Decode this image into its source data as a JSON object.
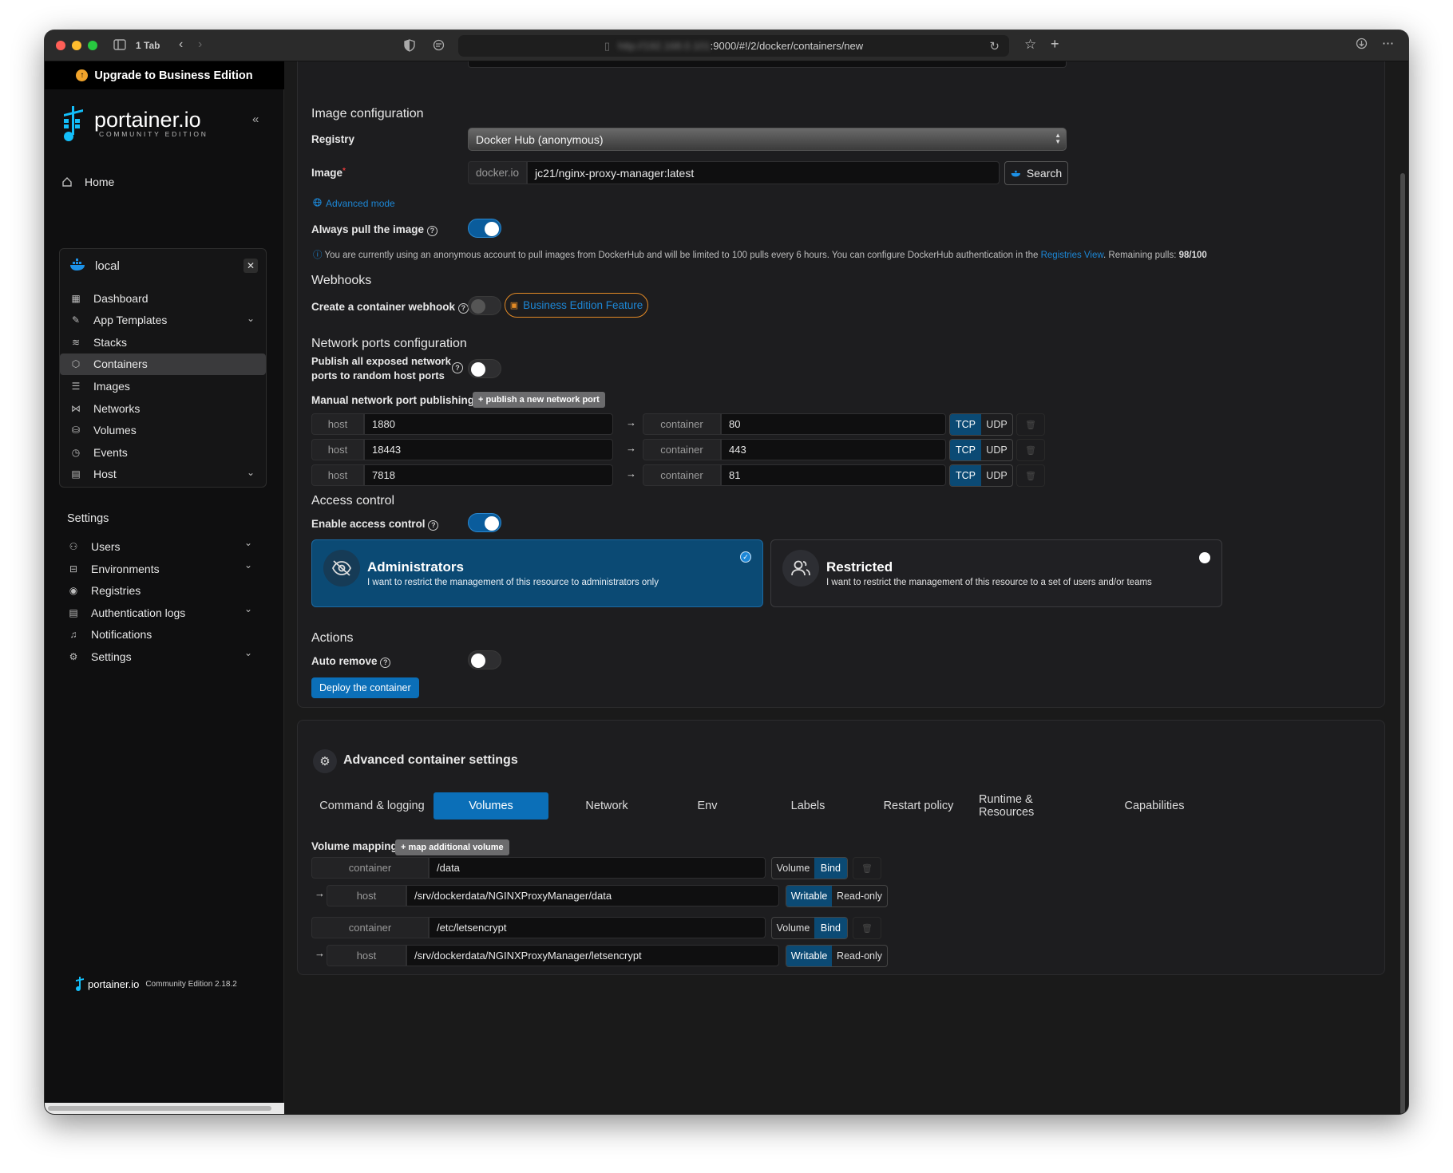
{
  "browser": {
    "tab_count": "1 Tab",
    "url_host": "http://192.168.0.101",
    "url_path": ":9000/#!/2/docker/containers/new"
  },
  "sidebar": {
    "upgrade": "Upgrade to Business Edition",
    "logo_main": "portainer.io",
    "logo_sub": "COMMUNITY EDITION",
    "home": "Home",
    "env_name": "local",
    "env_items": [
      {
        "label": "Dashboard",
        "icon": "dashboard-icon"
      },
      {
        "label": "App Templates",
        "icon": "edit-icon",
        "has_chevron": true
      },
      {
        "label": "Stacks",
        "icon": "layers-icon"
      },
      {
        "label": "Containers",
        "icon": "box-icon",
        "active": true
      },
      {
        "label": "Images",
        "icon": "list-icon"
      },
      {
        "label": "Networks",
        "icon": "share-icon"
      },
      {
        "label": "Volumes",
        "icon": "database-icon"
      },
      {
        "label": "Events",
        "icon": "clock-icon"
      },
      {
        "label": "Host",
        "icon": "server-icon",
        "has_chevron": true
      }
    ],
    "settings_title": "Settings",
    "settings_items": [
      {
        "label": "Users",
        "icon": "users-icon",
        "has_chevron": true
      },
      {
        "label": "Environments",
        "icon": "hdd-icon",
        "has_chevron": true
      },
      {
        "label": "Registries",
        "icon": "radio-icon"
      },
      {
        "label": "Authentication logs",
        "icon": "file-icon",
        "has_chevron": true
      },
      {
        "label": "Notifications",
        "icon": "bell-icon"
      },
      {
        "label": "Settings",
        "icon": "gear-icon",
        "has_chevron": true
      }
    ],
    "footer_logo": "portainer.io",
    "footer_edition": "Community Edition 2.18.2"
  },
  "image_config": {
    "title": "Image configuration",
    "registry_label": "Registry",
    "registry_value": "Docker Hub (anonymous)",
    "image_label": "Image",
    "image_prefix": "docker.io",
    "image_value": "jc21/nginx-proxy-manager:latest",
    "search_button": "Search",
    "advanced_mode": "Advanced mode",
    "always_pull_label": "Always pull the image",
    "always_pull": true,
    "notice_pre": "You are currently using an anonymous account to pull images from DockerHub and will be limited to 100 pulls every 6 hours. You can configure DockerHub authentication in the",
    "notice_link": "Registries View",
    "notice_mid": ". Remaining pulls:",
    "notice_pulls": "98/100"
  },
  "webhooks": {
    "title": "Webhooks",
    "label": "Create a container webhook",
    "be_feature": "Business Edition Feature"
  },
  "network_ports": {
    "title": "Network ports configuration",
    "publish_all_label_1": "Publish all exposed network",
    "publish_all_label_2": "ports to random host ports",
    "manual_label": "Manual network port publishing",
    "add_button": "publish a new network port",
    "host_label": "host",
    "container_label": "container",
    "tcp": "TCP",
    "udp": "UDP",
    "ports": [
      {
        "host": "1880",
        "container": "80",
        "protocol": "TCP"
      },
      {
        "host": "18443",
        "container": "443",
        "protocol": "TCP"
      },
      {
        "host": "7818",
        "container": "81",
        "protocol": "TCP"
      }
    ]
  },
  "access_control": {
    "title": "Access control",
    "enable_label": "Enable access control",
    "enabled": true,
    "admin_title": "Administrators",
    "admin_desc": "I want to restrict the management of this resource to administrators only",
    "restricted_title": "Restricted",
    "restricted_desc": "I want to restrict the management of this resource to a set of users and/or teams",
    "selected": "Administrators"
  },
  "actions": {
    "title": "Actions",
    "auto_remove_label": "Auto remove",
    "auto_remove": false,
    "deploy_button": "Deploy the container"
  },
  "advanced": {
    "title": "Advanced container settings",
    "tabs": [
      "Command & logging",
      "Volumes",
      "Network",
      "Env",
      "Labels",
      "Restart policy",
      "Runtime & Resources",
      "Capabilities"
    ],
    "active_tab": "Volumes",
    "volume_mapping_label": "Volume mapping",
    "add_volume_button": "map additional volume",
    "container_label": "container",
    "host_label": "host",
    "volume_opt": "Volume",
    "bind_opt": "Bind",
    "writable_opt": "Writable",
    "readonly_opt": "Read-only",
    "volumes": [
      {
        "container": "/data",
        "host": "/srv/dockerdata/NGINXProxyManager/data",
        "type": "Bind",
        "mode": "Writable"
      },
      {
        "container": "/etc/letsencrypt",
        "host": "/srv/dockerdata/NGINXProxyManager/letsencrypt",
        "type": "Bind",
        "mode": "Writable"
      }
    ]
  },
  "colors": {
    "accent": "#0b6fb8",
    "toggle_on": "#0a5c9c",
    "admin_card": "#0b4a74",
    "be_orange": "#e38a25"
  }
}
